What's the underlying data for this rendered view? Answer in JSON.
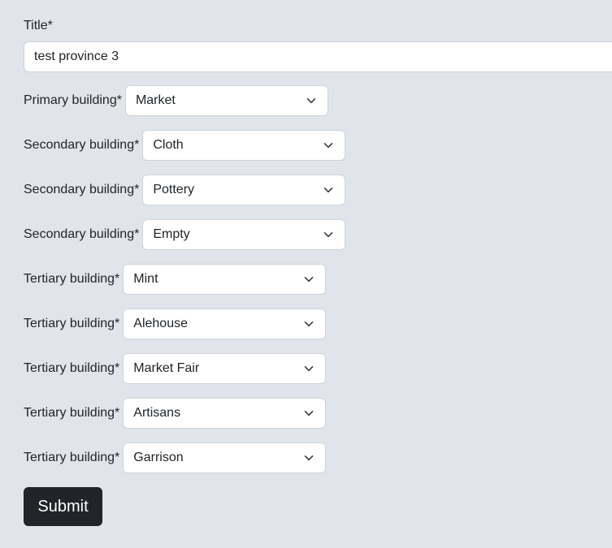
{
  "form": {
    "title_label": "Title*",
    "title_value": "test province 3",
    "rows": [
      {
        "label": "Primary building*",
        "value": "Market"
      },
      {
        "label": "Secondary building*",
        "value": "Cloth"
      },
      {
        "label": "Secondary building*",
        "value": "Pottery"
      },
      {
        "label": "Secondary building*",
        "value": "Empty"
      },
      {
        "label": "Tertiary building*",
        "value": "Mint"
      },
      {
        "label": "Tertiary building*",
        "value": "Alehouse"
      },
      {
        "label": "Tertiary building*",
        "value": "Market Fair"
      },
      {
        "label": "Tertiary building*",
        "value": "Artisans"
      },
      {
        "label": "Tertiary building*",
        "value": "Garrison"
      }
    ],
    "submit_label": "Submit"
  },
  "colors": {
    "background": "#e1e4eb",
    "button": "#212529",
    "text": "#212529"
  },
  "icons": {
    "select_arrow": "chevron-down-icon"
  }
}
